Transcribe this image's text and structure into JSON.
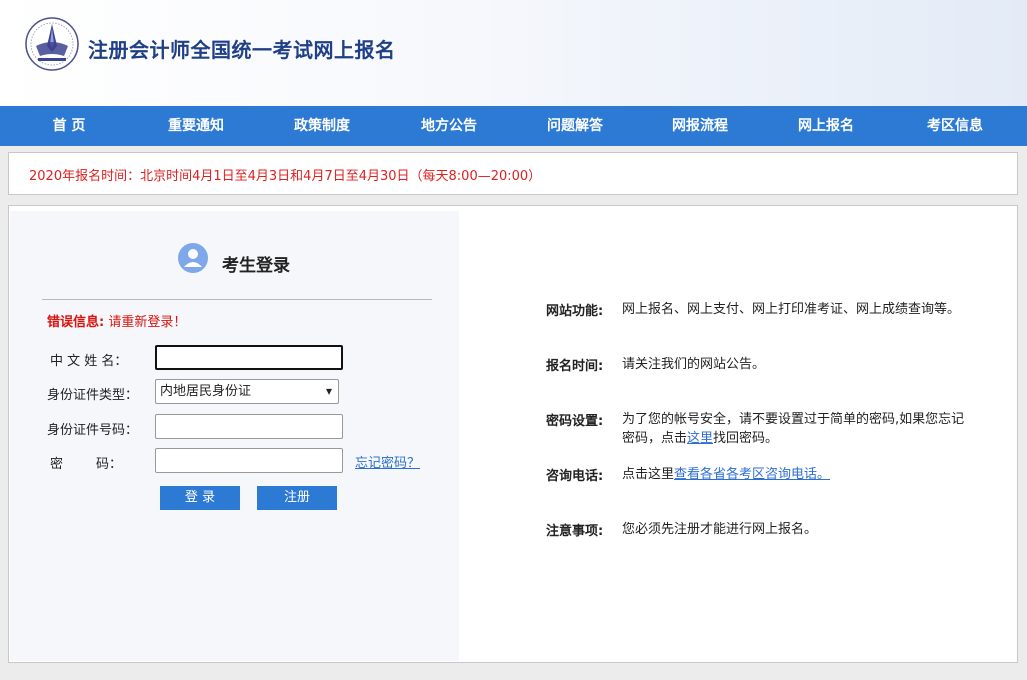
{
  "header": {
    "title": "注册会计师全国统一考试网上报名"
  },
  "nav": {
    "items": [
      "首 页",
      "重要通知",
      "政策制度",
      "地方公告",
      "问题解答",
      "网报流程",
      "网上报名",
      "考区信息"
    ]
  },
  "notice": {
    "text": "2020年报名时间：北京时间4月1日至4月3日和4月7日至4月30日（每天8:00—20:00）"
  },
  "login": {
    "title": "考生登录",
    "error_label": "错误信息:",
    "error_msg": " 请重新登录！",
    "name_label": "中 文 姓 名：",
    "id_type_label": "身份证件类型：",
    "id_type_value": "内地居民身份证",
    "id_number_label": "身份证件号码：",
    "password_label": "密        码：",
    "forgot": "忘记密码？",
    "login_button": "登 录",
    "register_button": "注册"
  },
  "info": {
    "function_label": "网站功能:",
    "function_text": "网上报名、网上支付、网上打印准考证、网上成绩查询等。",
    "time_label": "报名时间:",
    "time_text": "请关注我们的网站公告。",
    "password_label": "密码设置:",
    "password_text_1": "为了您的帐号安全，请不要设置过于简单的密码,如果您忘记密码，点击",
    "password_link": "这里",
    "password_text_2": "找回密码。",
    "phone_label": "咨询电话:",
    "phone_text": "点击这里",
    "phone_link": "查看各省各考区咨询电话。",
    "notes_label": "注意事项:",
    "notes_text": "您必须先注册才能进行网上报名。"
  },
  "colors": {
    "nav_bg": "#2d7ad4",
    "title": "#1f3f86",
    "notice": "#e02020",
    "error": "#d9140f",
    "link": "#2d6fd0"
  }
}
